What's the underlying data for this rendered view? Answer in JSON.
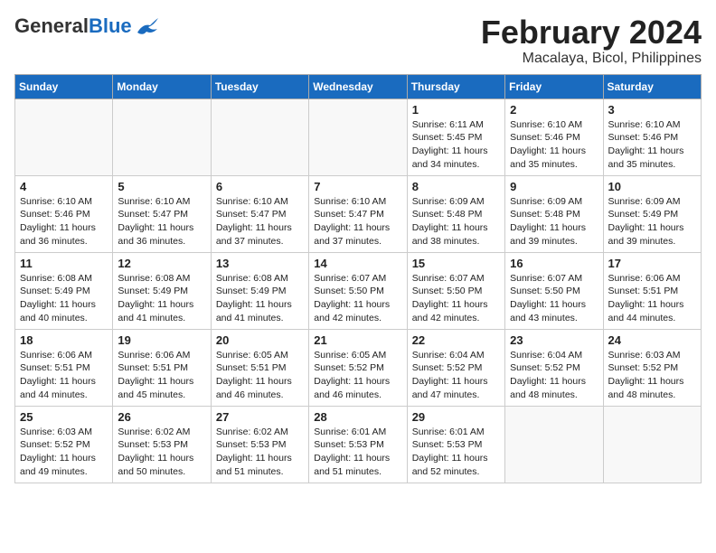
{
  "header": {
    "logo_general": "General",
    "logo_blue": "Blue",
    "month_year": "February 2024",
    "location": "Macalaya, Bicol, Philippines"
  },
  "days_of_week": [
    "Sunday",
    "Monday",
    "Tuesday",
    "Wednesday",
    "Thursday",
    "Friday",
    "Saturday"
  ],
  "weeks": [
    [
      {
        "day": "",
        "info": ""
      },
      {
        "day": "",
        "info": ""
      },
      {
        "day": "",
        "info": ""
      },
      {
        "day": "",
        "info": ""
      },
      {
        "day": "1",
        "info": "Sunrise: 6:11 AM\nSunset: 5:45 PM\nDaylight: 11 hours\nand 34 minutes."
      },
      {
        "day": "2",
        "info": "Sunrise: 6:10 AM\nSunset: 5:46 PM\nDaylight: 11 hours\nand 35 minutes."
      },
      {
        "day": "3",
        "info": "Sunrise: 6:10 AM\nSunset: 5:46 PM\nDaylight: 11 hours\nand 35 minutes."
      }
    ],
    [
      {
        "day": "4",
        "info": "Sunrise: 6:10 AM\nSunset: 5:46 PM\nDaylight: 11 hours\nand 36 minutes."
      },
      {
        "day": "5",
        "info": "Sunrise: 6:10 AM\nSunset: 5:47 PM\nDaylight: 11 hours\nand 36 minutes."
      },
      {
        "day": "6",
        "info": "Sunrise: 6:10 AM\nSunset: 5:47 PM\nDaylight: 11 hours\nand 37 minutes."
      },
      {
        "day": "7",
        "info": "Sunrise: 6:10 AM\nSunset: 5:47 PM\nDaylight: 11 hours\nand 37 minutes."
      },
      {
        "day": "8",
        "info": "Sunrise: 6:09 AM\nSunset: 5:48 PM\nDaylight: 11 hours\nand 38 minutes."
      },
      {
        "day": "9",
        "info": "Sunrise: 6:09 AM\nSunset: 5:48 PM\nDaylight: 11 hours\nand 39 minutes."
      },
      {
        "day": "10",
        "info": "Sunrise: 6:09 AM\nSunset: 5:49 PM\nDaylight: 11 hours\nand 39 minutes."
      }
    ],
    [
      {
        "day": "11",
        "info": "Sunrise: 6:08 AM\nSunset: 5:49 PM\nDaylight: 11 hours\nand 40 minutes."
      },
      {
        "day": "12",
        "info": "Sunrise: 6:08 AM\nSunset: 5:49 PM\nDaylight: 11 hours\nand 41 minutes."
      },
      {
        "day": "13",
        "info": "Sunrise: 6:08 AM\nSunset: 5:49 PM\nDaylight: 11 hours\nand 41 minutes."
      },
      {
        "day": "14",
        "info": "Sunrise: 6:07 AM\nSunset: 5:50 PM\nDaylight: 11 hours\nand 42 minutes."
      },
      {
        "day": "15",
        "info": "Sunrise: 6:07 AM\nSunset: 5:50 PM\nDaylight: 11 hours\nand 42 minutes."
      },
      {
        "day": "16",
        "info": "Sunrise: 6:07 AM\nSunset: 5:50 PM\nDaylight: 11 hours\nand 43 minutes."
      },
      {
        "day": "17",
        "info": "Sunrise: 6:06 AM\nSunset: 5:51 PM\nDaylight: 11 hours\nand 44 minutes."
      }
    ],
    [
      {
        "day": "18",
        "info": "Sunrise: 6:06 AM\nSunset: 5:51 PM\nDaylight: 11 hours\nand 44 minutes."
      },
      {
        "day": "19",
        "info": "Sunrise: 6:06 AM\nSunset: 5:51 PM\nDaylight: 11 hours\nand 45 minutes."
      },
      {
        "day": "20",
        "info": "Sunrise: 6:05 AM\nSunset: 5:51 PM\nDaylight: 11 hours\nand 46 minutes."
      },
      {
        "day": "21",
        "info": "Sunrise: 6:05 AM\nSunset: 5:52 PM\nDaylight: 11 hours\nand 46 minutes."
      },
      {
        "day": "22",
        "info": "Sunrise: 6:04 AM\nSunset: 5:52 PM\nDaylight: 11 hours\nand 47 minutes."
      },
      {
        "day": "23",
        "info": "Sunrise: 6:04 AM\nSunset: 5:52 PM\nDaylight: 11 hours\nand 48 minutes."
      },
      {
        "day": "24",
        "info": "Sunrise: 6:03 AM\nSunset: 5:52 PM\nDaylight: 11 hours\nand 48 minutes."
      }
    ],
    [
      {
        "day": "25",
        "info": "Sunrise: 6:03 AM\nSunset: 5:52 PM\nDaylight: 11 hours\nand 49 minutes."
      },
      {
        "day": "26",
        "info": "Sunrise: 6:02 AM\nSunset: 5:53 PM\nDaylight: 11 hours\nand 50 minutes."
      },
      {
        "day": "27",
        "info": "Sunrise: 6:02 AM\nSunset: 5:53 PM\nDaylight: 11 hours\nand 51 minutes."
      },
      {
        "day": "28",
        "info": "Sunrise: 6:01 AM\nSunset: 5:53 PM\nDaylight: 11 hours\nand 51 minutes."
      },
      {
        "day": "29",
        "info": "Sunrise: 6:01 AM\nSunset: 5:53 PM\nDaylight: 11 hours\nand 52 minutes."
      },
      {
        "day": "",
        "info": ""
      },
      {
        "day": "",
        "info": ""
      }
    ]
  ]
}
